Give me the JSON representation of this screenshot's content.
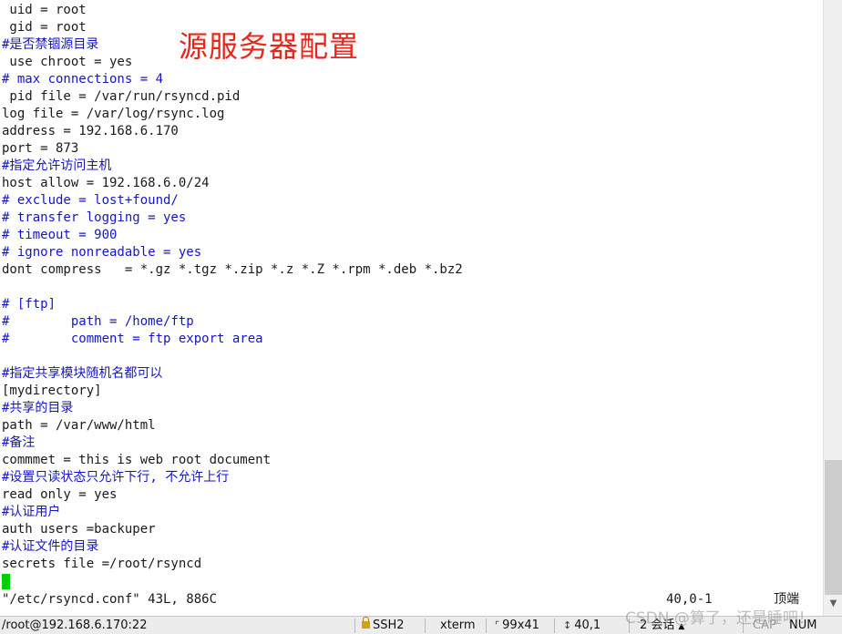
{
  "overlay_title": "源服务器配置",
  "lines": [
    {
      "text": " uid = root",
      "kind": "normal"
    },
    {
      "text": " gid = root",
      "kind": "normal"
    },
    {
      "text": "#是否禁锢源目录",
      "kind": "comment"
    },
    {
      "text": " use chroot = yes",
      "kind": "normal"
    },
    {
      "text": "# max connections = 4",
      "kind": "comment"
    },
    {
      "text": " pid file = /var/run/rsyncd.pid",
      "kind": "normal"
    },
    {
      "text": "log file = /var/log/rsync.log",
      "kind": "normal"
    },
    {
      "text": "address = 192.168.6.170",
      "kind": "normal"
    },
    {
      "text": "port = 873",
      "kind": "normal"
    },
    {
      "text": "#指定允许访问主机",
      "kind": "comment"
    },
    {
      "text": "host allow = 192.168.6.0/24",
      "kind": "normal"
    },
    {
      "text": "# exclude = lost+found/",
      "kind": "comment"
    },
    {
      "text": "# transfer logging = yes",
      "kind": "comment"
    },
    {
      "text": "# timeout = 900",
      "kind": "comment"
    },
    {
      "text": "# ignore nonreadable = yes",
      "kind": "comment"
    },
    {
      "text": "dont compress   = *.gz *.tgz *.zip *.z *.Z *.rpm *.deb *.bz2",
      "kind": "normal"
    },
    {
      "text": "",
      "kind": "normal"
    },
    {
      "text": "# [ftp]",
      "kind": "comment"
    },
    {
      "text": "#        path = /home/ftp",
      "kind": "comment"
    },
    {
      "text": "#        comment = ftp export area",
      "kind": "comment"
    },
    {
      "text": "",
      "kind": "normal"
    },
    {
      "text": "#指定共享模块随机名都可以",
      "kind": "comment"
    },
    {
      "text": "[mydirectory]",
      "kind": "normal"
    },
    {
      "text": "#共享的目录",
      "kind": "comment"
    },
    {
      "text": "path = /var/www/html",
      "kind": "normal"
    },
    {
      "text": "#备注",
      "kind": "comment"
    },
    {
      "text": "commmet = this is web root document",
      "kind": "normal"
    },
    {
      "text": "#设置只读状态只允许下行, 不允许上行",
      "kind": "comment"
    },
    {
      "text": "read only = yes",
      "kind": "normal"
    },
    {
      "text": "#认证用户",
      "kind": "comment"
    },
    {
      "text": "auth users =backuper",
      "kind": "normal"
    },
    {
      "text": "#认证文件的目录",
      "kind": "comment"
    },
    {
      "text": "secrets file =/root/rsyncd",
      "kind": "normal"
    }
  ],
  "status": {
    "file_info": "\"/etc/rsyncd.conf\" 43L, 886C",
    "position": "40,0-1",
    "scroll": "顶端"
  },
  "appbar": {
    "host": "/root@192.168.6.170:22",
    "protocol": "SSH2",
    "term": "xterm",
    "size": "99x41",
    "cursor": "40,1",
    "sessions": "2 会话",
    "caps": "CAP",
    "num": "NUM"
  },
  "icons": {
    "lock": "lock-icon",
    "grip": "resize-grip-icon",
    "scroll_down": "scroll-down-arrow-icon"
  },
  "watermark": "CSDN @算了，还是睡吧！",
  "colors": {
    "comment": "#1515c8",
    "text": "#1a1a1a",
    "cursor": "#00d000",
    "overlay": "#e8261b"
  }
}
